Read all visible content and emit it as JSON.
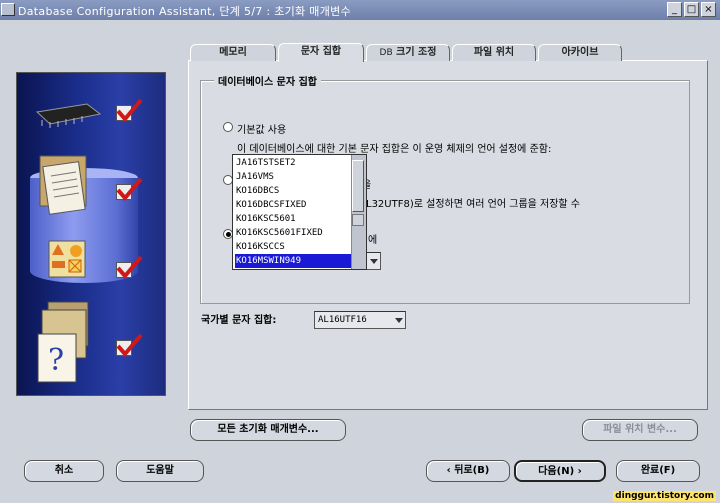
{
  "window": {
    "title": "Database Configuration Assistant, 단계 5/7 : 초기화 매개변수",
    "min": "_",
    "max": "□",
    "close": "×"
  },
  "tabs": [
    {
      "label": "메모리"
    },
    {
      "label": "문자 집합"
    },
    {
      "prefix": "DB",
      "label": "크기 조정"
    },
    {
      "label": "파일 위치"
    },
    {
      "label": "아카이브"
    }
  ],
  "charset": {
    "group_title": "데이터베이스 문자 집합",
    "radio_default_label": "기본값 사용",
    "default_desc": "이 데이터베이스에 대한 기본 문자 집합은 이 운영 체제의 언어 설정에 준함:",
    "unicode_fragment": "L32UTF8)로 설정하면 여러 언어 그룹을 저장할 수",
    "fragment_a": "을",
    "fragment_b": "에"
  },
  "charset_list": {
    "items": [
      "JA16TSTSET2",
      "JA16VMS",
      "KO16DBCS",
      "KO16DBCSFIXED",
      "KO16KSC5601",
      "KO16KSC5601FIXED",
      "KO16KSCCS",
      "KO16MSWIN949"
    ],
    "selected": "KO16MSWIN949"
  },
  "national_charset": {
    "label": "국가별 문자 집합:",
    "value": "AL16UTF16"
  },
  "buttons": {
    "all_params": "모든 초기화 매개변수...",
    "file_location_vars": "파일 위치 변수...",
    "cancel": "취소",
    "help": "도움말",
    "back": "뒤로(B)",
    "next": "다음(N)",
    "finish": "완료(F)"
  },
  "watermark": "dinggur.tistory.com"
}
